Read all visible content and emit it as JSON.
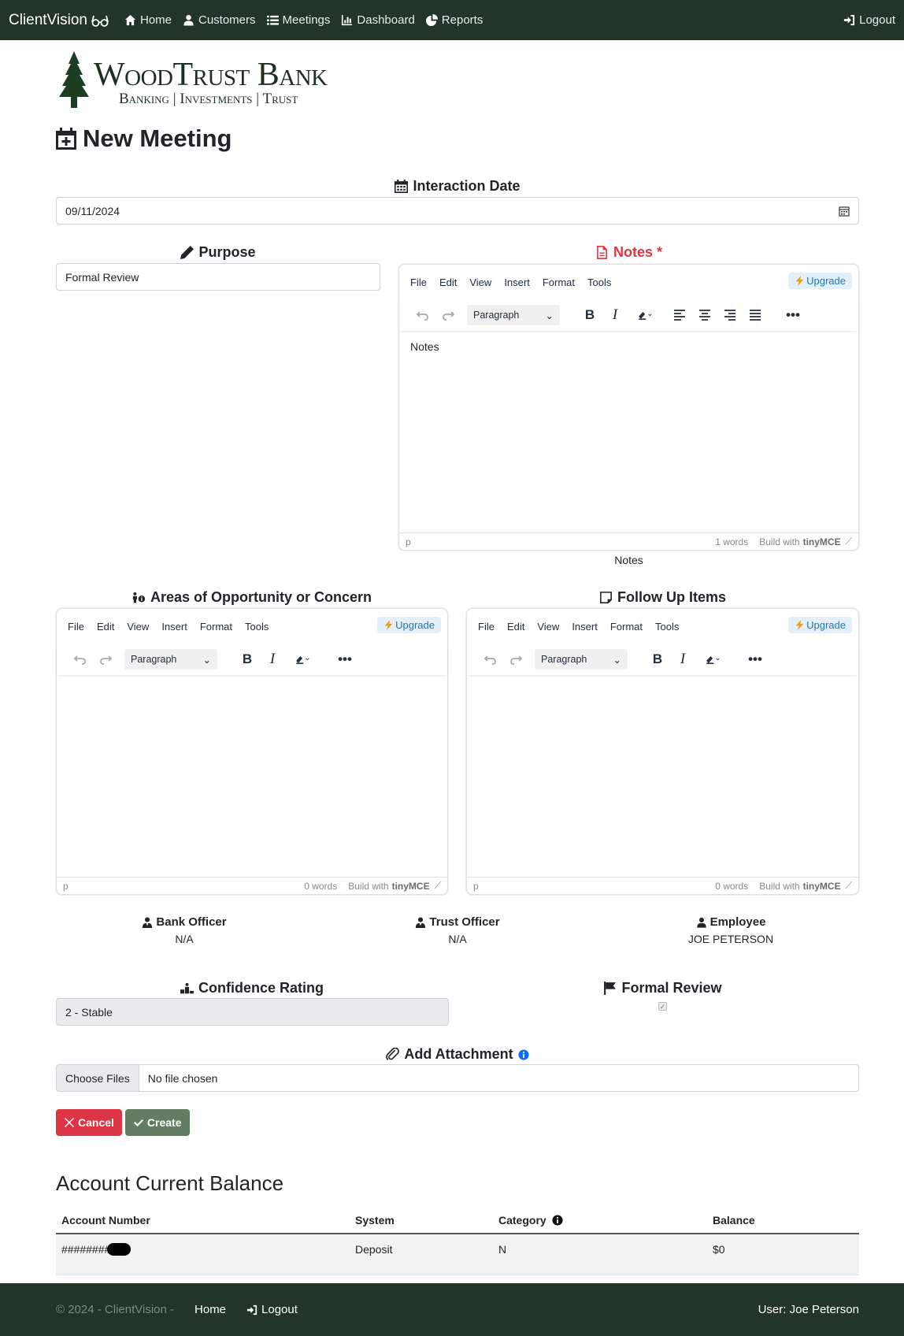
{
  "nav": {
    "brand": "ClientVision",
    "items": [
      "Home",
      "Customers",
      "Meetings",
      "Dashboard",
      "Reports"
    ],
    "logout": "Logout"
  },
  "logo": {
    "name": "WoodTrust Bank",
    "tagline": "Banking | Investments | Trust"
  },
  "page_title": "New Meeting",
  "interaction_date": {
    "label": "Interaction Date",
    "value": "09/11/2024"
  },
  "purpose": {
    "label": "Purpose",
    "value": "Formal Review"
  },
  "notes": {
    "label": "Notes *",
    "body": "Notes",
    "word_count": "1 words",
    "caption": "Notes"
  },
  "editor": {
    "menu": [
      "File",
      "Edit",
      "View",
      "Insert",
      "Format",
      "Tools"
    ],
    "upgrade": "Upgrade",
    "block_format": "Paragraph",
    "path": "p",
    "build_with": "Build with",
    "brand": "tinyMCE"
  },
  "opportunity": {
    "label": "Areas of Opportunity or Concern",
    "word_count": "0 words"
  },
  "follow_up": {
    "label": "Follow Up Items",
    "word_count": "0 words"
  },
  "officers": {
    "bank_officer": {
      "label": "Bank Officer",
      "value": "N/A"
    },
    "trust_officer": {
      "label": "Trust Officer",
      "value": "N/A"
    },
    "employee": {
      "label": "Employee",
      "value": "JOE PETERSON"
    }
  },
  "confidence": {
    "label": "Confidence Rating",
    "value": "2 - Stable"
  },
  "formal_review": {
    "label": "Formal Review",
    "checked": true
  },
  "attachment": {
    "label": "Add Attachment",
    "button": "Choose Files",
    "status": "No file chosen"
  },
  "actions": {
    "cancel": "Cancel",
    "create": "Create"
  },
  "balance": {
    "title": "Account Current Balance",
    "columns": [
      "Account Number",
      "System",
      "Category",
      "Balance"
    ],
    "rows": [
      [
        "########",
        "Deposit",
        "N",
        "$0"
      ]
    ]
  },
  "footer": {
    "copyright": "© 2024 - ClientVision -",
    "home": "Home",
    "logout": "Logout",
    "user": "User: Joe Peterson"
  },
  "colors": {
    "nav_bg": "#223527",
    "danger": "#dc3545",
    "create": "#627d63"
  }
}
